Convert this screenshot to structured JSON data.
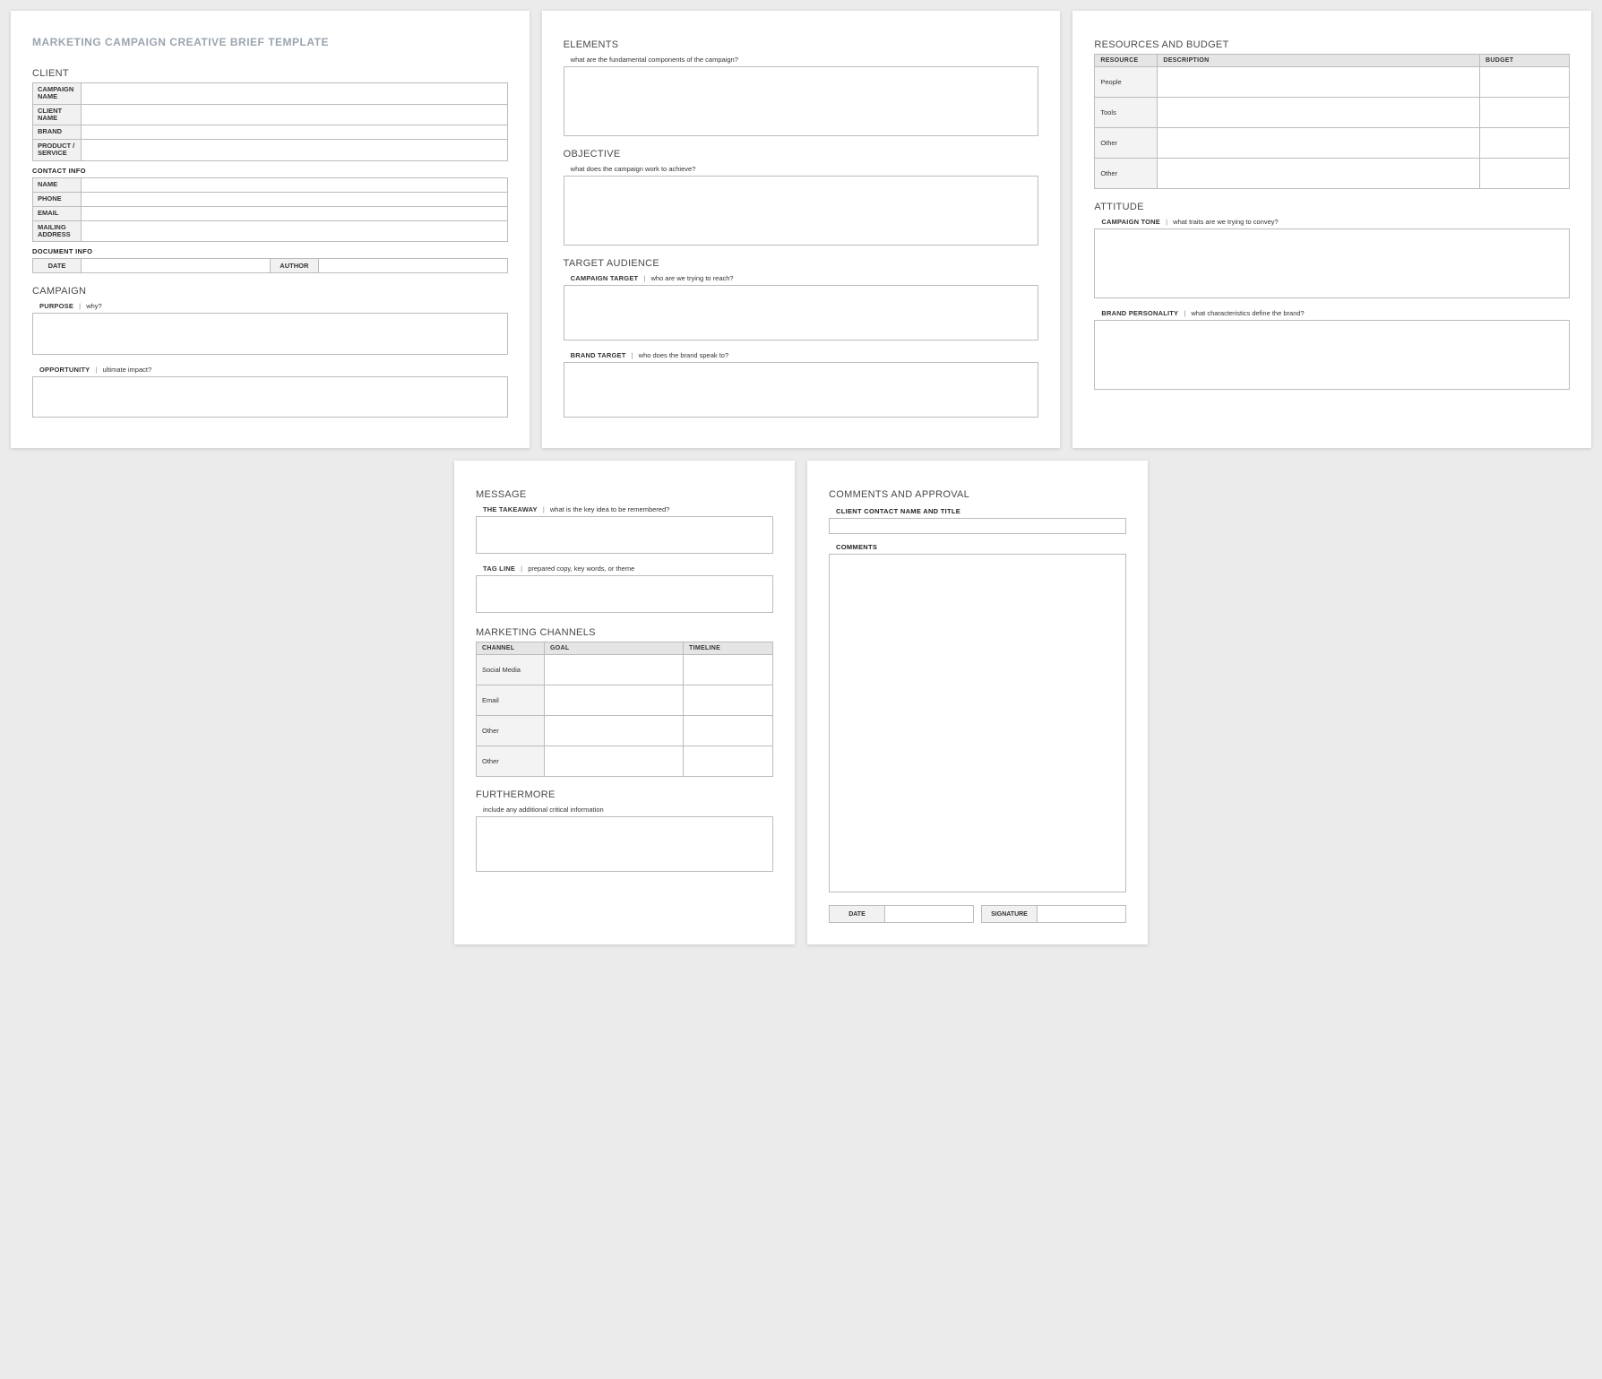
{
  "title": "MARKETING CAMPAIGN CREATIVE BRIEF TEMPLATE",
  "page1": {
    "client_heading": "CLIENT",
    "fields": {
      "campaign_name": "CAMPAIGN NAME",
      "client_name": "CLIENT NAME",
      "brand": "BRAND",
      "product_service": "PRODUCT / SERVICE"
    },
    "contact_info_heading": "CONTACT INFO",
    "contact_fields": {
      "name": "NAME",
      "phone": "PHONE",
      "email": "EMAIL",
      "mailing_address": "MAILING ADDRESS"
    },
    "doc_info_heading": "DOCUMENT INFO",
    "doc_info": {
      "date": "DATE",
      "author": "AUTHOR"
    },
    "campaign_heading": "CAMPAIGN",
    "purpose": {
      "label": "PURPOSE",
      "hint": "why?"
    },
    "opportunity": {
      "label": "OPPORTUNITY",
      "hint": "ultimate impact?"
    }
  },
  "page2": {
    "elements_heading": "ELEMENTS",
    "elements_hint": "what are the fundamental components of the campaign?",
    "objective_heading": "OBJECTIVE",
    "objective_hint": "what does the campaign work to achieve?",
    "target_heading": "TARGET AUDIENCE",
    "campaign_target": {
      "label": "CAMPAIGN TARGET",
      "hint": "who are we trying to reach?"
    },
    "brand_target": {
      "label": "BRAND TARGET",
      "hint": "who does the brand speak to?"
    }
  },
  "page3": {
    "resources_heading": "RESOURCES AND BUDGET",
    "cols": {
      "resource": "RESOURCE",
      "description": "DESCRIPTION",
      "budget": "BUDGET"
    },
    "rows": [
      "People",
      "Tools",
      "Other",
      "Other"
    ],
    "attitude_heading": "ATTITUDE",
    "campaign_tone": {
      "label": "CAMPAIGN TONE",
      "hint": "what traits are we trying to convey?"
    },
    "brand_personality": {
      "label": "BRAND PERSONALITY",
      "hint": "what characteristics define the brand?"
    }
  },
  "page4": {
    "message_heading": "MESSAGE",
    "takeaway": {
      "label": "THE TAKEAWAY",
      "hint": "what is the key idea to be remembered?"
    },
    "tagline": {
      "label": "TAG LINE",
      "hint": "prepared copy, key words, or theme"
    },
    "channels_heading": "MARKETING CHANNELS",
    "cols": {
      "channel": "CHANNEL",
      "goal": "GOAL",
      "timeline": "TIMELINE"
    },
    "rows": [
      "Social Media",
      "Email",
      "Other",
      "Other"
    ],
    "furthermore_heading": "FURTHERMORE",
    "furthermore_hint": "include any additional critical information"
  },
  "page5": {
    "heading": "COMMENTS AND APPROVAL",
    "contact_label": "CLIENT CONTACT NAME AND TITLE",
    "comments_label": "COMMENTS",
    "date_label": "DATE",
    "signature_label": "SIGNATURE"
  }
}
